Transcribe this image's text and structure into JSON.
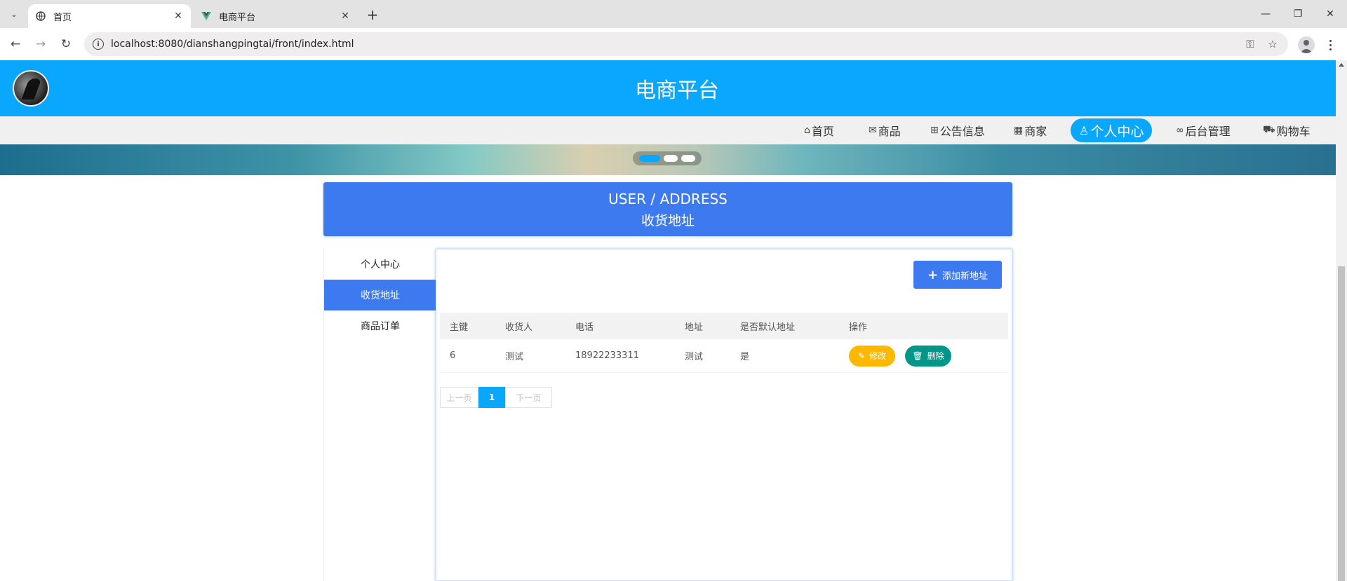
{
  "browser": {
    "tabs": [
      {
        "title": "首页",
        "active": true
      },
      {
        "title": "电商平台",
        "active": false
      }
    ],
    "url": "localhost:8080/dianshangpingtai/front/index.html"
  },
  "site": {
    "title": "电商平台",
    "nav": [
      {
        "label": "首页",
        "icon": "home-icon"
      },
      {
        "label": "商品",
        "icon": "mail-icon"
      },
      {
        "label": "公告信息",
        "icon": "gift-icon"
      },
      {
        "label": "商家",
        "icon": "calendar-icon"
      },
      {
        "label": "个人中心",
        "icon": "user-icon",
        "active": true
      },
      {
        "label": "后台管理",
        "icon": "link-icon"
      },
      {
        "label": "购物车",
        "icon": "cart-icon"
      }
    ],
    "banner_slides": 3,
    "banner_active_slide": 1
  },
  "section": {
    "title_en": "USER / ADDRESS",
    "title_cn": "收货地址"
  },
  "side_menu": [
    {
      "label": "个人中心",
      "active": false
    },
    {
      "label": "收货地址",
      "active": true
    },
    {
      "label": "商品订单",
      "active": false
    }
  ],
  "address": {
    "add_label": "添加新地址",
    "columns": [
      "主键",
      "收货人",
      "电话",
      "地址",
      "是否默认地址",
      "操作"
    ],
    "rows": [
      {
        "id": "6",
        "name": "测试",
        "phone": "18922233311",
        "address": "测试",
        "is_default": "是",
        "edit_label": "修改",
        "delete_label": "删除"
      }
    ],
    "pager": {
      "prev": "上一页",
      "current": "1",
      "next": "下一页"
    }
  },
  "colors": {
    "header": "#0aa7ff",
    "primary": "#3d7af0",
    "edit": "#ffb800",
    "delete": "#009688"
  }
}
